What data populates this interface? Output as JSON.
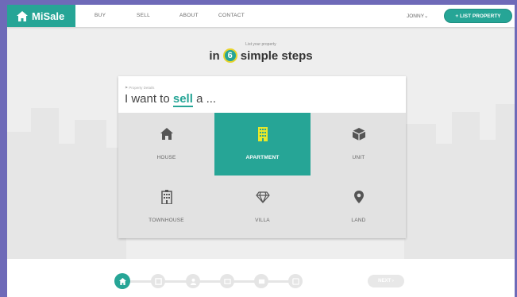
{
  "brand": {
    "name": "MiSale"
  },
  "nav": {
    "links": [
      "BUY",
      "SELL",
      "ABOUT",
      "CONTACT"
    ],
    "user": "JONNY",
    "cta": "+ LIST PROPERTY"
  },
  "header": {
    "subtitle": "List your property",
    "title_prefix": "in",
    "step_count": "6",
    "title_suffix": "simple steps"
  },
  "card": {
    "caption": "Property Details",
    "prompt_start": "I want to",
    "prompt_highlight": "sell",
    "prompt_end": "a ...",
    "options": [
      {
        "label": "HOUSE",
        "icon": "house-icon",
        "selected": false
      },
      {
        "label": "APARTMENT",
        "icon": "apartment-icon",
        "selected": true
      },
      {
        "label": "UNIT",
        "icon": "cube-icon",
        "selected": false
      },
      {
        "label": "TOWNHOUSE",
        "icon": "townhouse-icon",
        "selected": false
      },
      {
        "label": "VILLA",
        "icon": "diamond-icon",
        "selected": false
      },
      {
        "label": "LAND",
        "icon": "map-pin-icon",
        "selected": false
      }
    ]
  },
  "footer": {
    "steps": [
      {
        "icon": "home-icon",
        "done": true
      },
      {
        "icon": "details-icon",
        "done": false
      },
      {
        "icon": "person-icon",
        "done": false
      },
      {
        "icon": "photo-icon",
        "done": false
      },
      {
        "icon": "mail-icon",
        "done": false
      },
      {
        "icon": "preview-icon",
        "done": false
      }
    ],
    "next_label": "NEXT"
  },
  "colors": {
    "accent": "#26a596",
    "highlight": "#e8d42a",
    "outer": "#6e6ab8"
  }
}
